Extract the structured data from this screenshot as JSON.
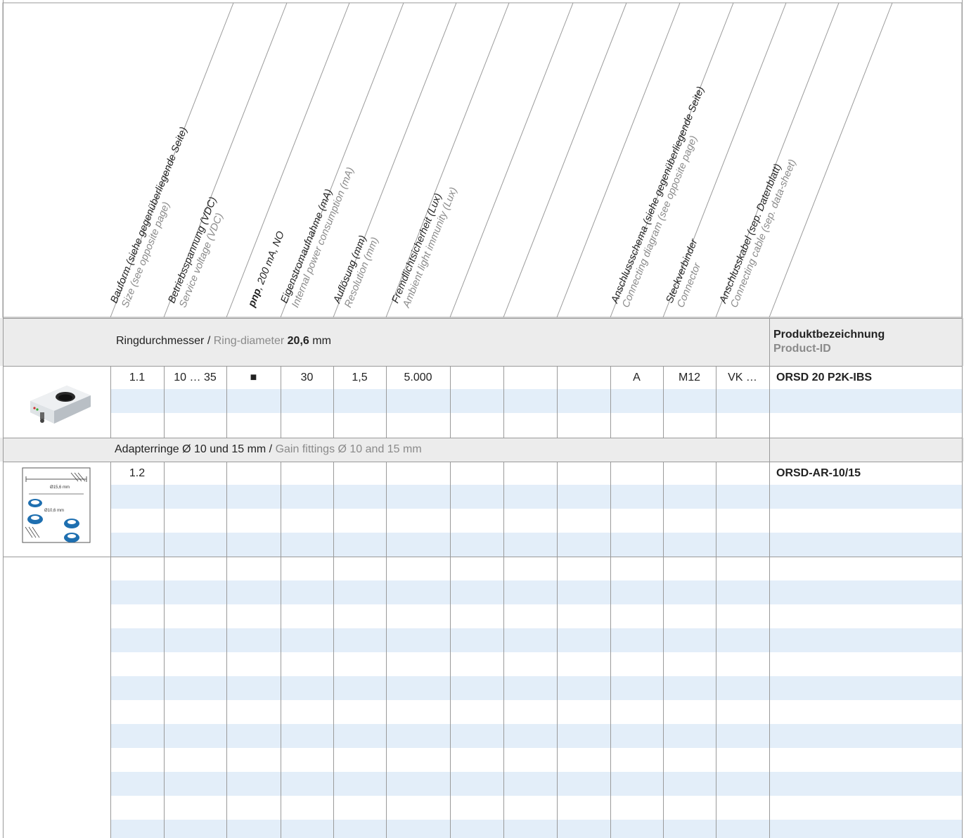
{
  "columns": [
    {
      "de": "Bauform (siehe gegenüberliegende Seite)",
      "en": "Size (see opposite page)"
    },
    {
      "de": "Betriebsspannung (VDC)",
      "en": "Service voltage (VDC)"
    },
    {
      "de_bold": "pnp",
      "de": ", 200 mA, NO",
      "en": ""
    },
    {
      "de": "Eigenstromaufnahme (mA)",
      "en": "Internal power consumption (mA)"
    },
    {
      "de": "Auflösung (mm)",
      "en": "Resolution (mm)"
    },
    {
      "de": "Fremdlichtsicherheit (Lux)",
      "en": "Ambient light immunity (Lux)"
    },
    {
      "de": "",
      "en": ""
    },
    {
      "de": "",
      "en": ""
    },
    {
      "de": "",
      "en": ""
    },
    {
      "de": "Anschlussschema (siehe gegenüberliegende Seite)",
      "en": "Connecting diagram (see opposite page)"
    },
    {
      "de": "Steckverbinder",
      "en": "Connector"
    },
    {
      "de": "Anschlusskabel (sep. Datenblatt)",
      "en": "Connecting cable (sep. data-sheet)"
    }
  ],
  "product_id_header": {
    "de": "Produktbezeichnung",
    "en": "Product-ID"
  },
  "groups": [
    {
      "title_de": "Ringdurchmesser / ",
      "title_en": "Ring-diameter ",
      "title_value": "20,6",
      "title_unit": " mm",
      "image": "ring-sensor-photo",
      "row": {
        "cells": [
          "1.1",
          "10 … 35",
          "■",
          "30",
          "1,5",
          "5.000",
          "",
          "",
          "",
          "A",
          "M12",
          "VK …"
        ],
        "product_id": "ORSD 20 P2K-IBS"
      }
    },
    {
      "title_full": "Adapterringe Ø 10 und 15 mm / ",
      "title_en": "Gain fittings Ø 10 and 15 mm",
      "image": "adapter-rings-drawing",
      "image_labels": [
        "Ø15,6 mm",
        "Ø10,6 mm"
      ],
      "row": {
        "cells": [
          "1.2",
          "",
          "",
          "",
          "",
          "",
          "",
          "",
          "",
          "",
          "",
          ""
        ],
        "product_id": "ORSD-AR-10/15"
      }
    }
  ],
  "colors": {
    "band": "#ececec",
    "stripe": "#e3eef9",
    "grid": "#9a9a9a",
    "english_text": "#8a8a8a"
  }
}
